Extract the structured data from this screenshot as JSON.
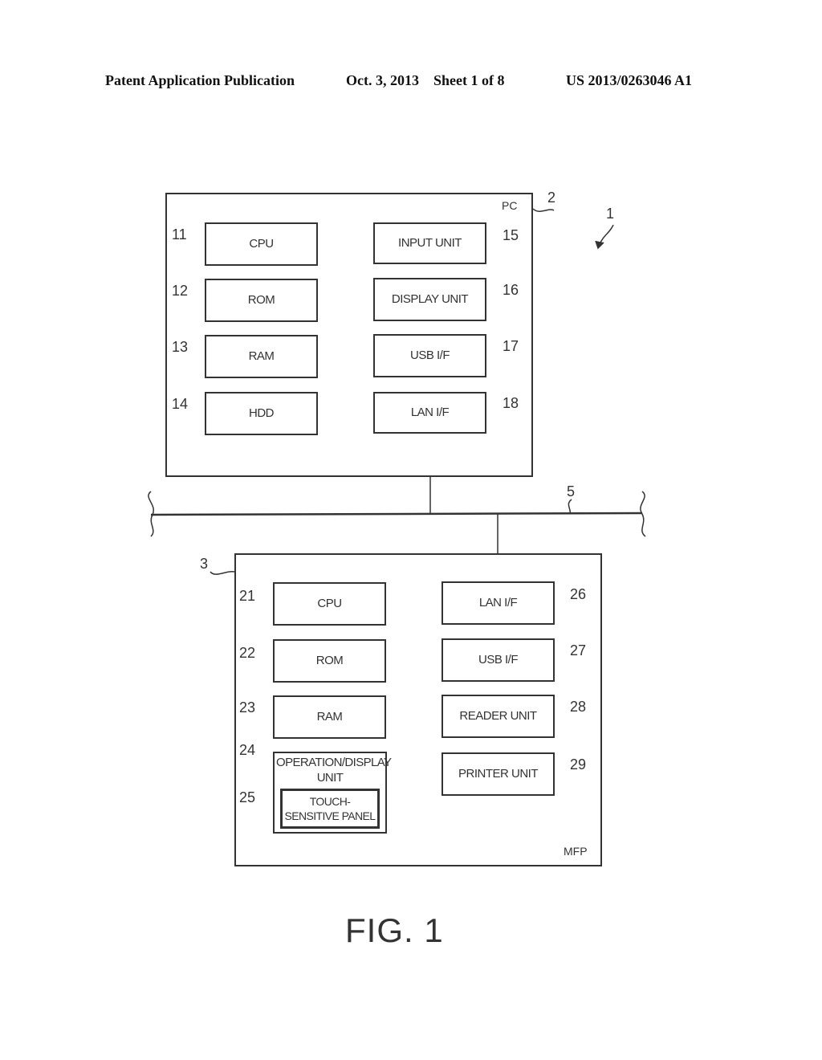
{
  "header": {
    "left": "Patent Application Publication",
    "middle": "Oct. 3, 2013    Sheet 1 of 8",
    "right": "US 2013/0263046 A1"
  },
  "system_ref": "1",
  "network": {
    "ref": "5"
  },
  "pc": {
    "ref": "2",
    "label": "PC",
    "left_blocks": [
      {
        "ref": "11",
        "label": "CPU"
      },
      {
        "ref": "12",
        "label": "ROM"
      },
      {
        "ref": "13",
        "label": "RAM"
      },
      {
        "ref": "14",
        "label": "HDD"
      }
    ],
    "right_blocks": [
      {
        "ref": "15",
        "label": "INPUT UNIT"
      },
      {
        "ref": "16",
        "label": "DISPLAY UNIT"
      },
      {
        "ref": "17",
        "label": "USB I/F"
      },
      {
        "ref": "18",
        "label": "LAN I/F"
      }
    ]
  },
  "mfp": {
    "ref": "3",
    "label": "MFP",
    "left_blocks": [
      {
        "ref": "21",
        "label": "CPU"
      },
      {
        "ref": "22",
        "label": "ROM"
      },
      {
        "ref": "23",
        "label": "RAM"
      },
      {
        "ref": "24",
        "label": "OPERATION/DISPLAY UNIT"
      }
    ],
    "panel": {
      "ref": "25",
      "label": "TOUCH-SENSITIVE PANEL"
    },
    "right_blocks": [
      {
        "ref": "26",
        "label": "LAN I/F"
      },
      {
        "ref": "27",
        "label": "USB I/F"
      },
      {
        "ref": "28",
        "label": "READER UNIT"
      },
      {
        "ref": "29",
        "label": "PRINTER UNIT"
      }
    ]
  },
  "figure_label": "FIG. 1"
}
